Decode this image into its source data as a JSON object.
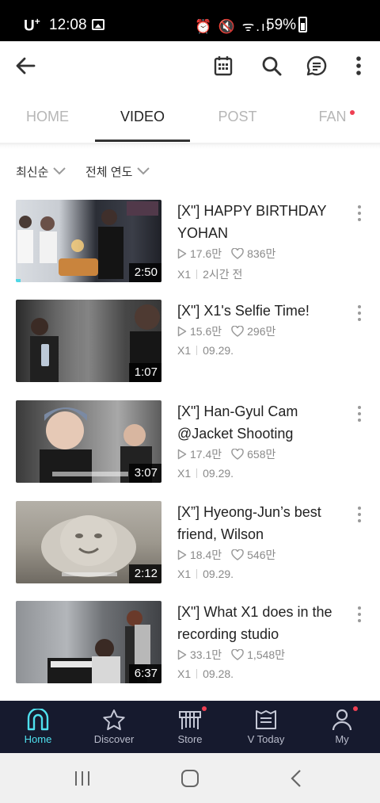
{
  "status_bar": {
    "carrier": "U",
    "carrier_sup": "+",
    "time": "12:08",
    "icons_text": "⏰ 🔇 ᯤ.ıl",
    "battery_percent": "59%"
  },
  "toolbar": {
    "back_icon": "back-arrow-icon",
    "calendar_icon": "calendar-icon",
    "search_icon": "search-icon",
    "chat_icon": "chat-icon",
    "more_icon": "more-vertical-icon"
  },
  "tabs": [
    {
      "label": "HOME",
      "active": false
    },
    {
      "label": "VIDEO",
      "active": true
    },
    {
      "label": "POST",
      "active": false
    },
    {
      "label": "FAN",
      "active": false,
      "has_notification": true
    }
  ],
  "filters": {
    "sort_label": "최신순",
    "year_label": "전체 연도"
  },
  "videos": [
    {
      "title": "[X\"] HAPPY BIRTHDAY YOHAN",
      "duration": "2:50",
      "views": "17.6만",
      "likes": "836만",
      "channel": "X1",
      "date": "2시간 전",
      "watched_fraction": 0.03
    },
    {
      "title": "[X\"] X1's Selfie Time!",
      "duration": "1:07",
      "views": "15.6만",
      "likes": "296만",
      "channel": "X1",
      "date": "09.29."
    },
    {
      "title": "[X\"] Han-Gyul Cam @Jacket Shooting",
      "duration": "3:07",
      "views": "17.4만",
      "likes": "658만",
      "channel": "X1",
      "date": "09.29."
    },
    {
      "title": "[X”] Hyeong-Jun’s best friend, Wilson",
      "duration": "2:12",
      "views": "18.4만",
      "likes": "546만",
      "channel": "X1",
      "date": "09.29."
    },
    {
      "title": "[X\"] What X1 does in the recording studio",
      "duration": "6:37",
      "views": "33.1만",
      "likes": "1,548만",
      "channel": "X1",
      "date": "09.28."
    }
  ],
  "bottom_nav": [
    {
      "label": "Home",
      "icon": "home-icon",
      "active": true
    },
    {
      "label": "Discover",
      "icon": "star-icon",
      "active": false
    },
    {
      "label": "Store",
      "icon": "store-icon",
      "active": false,
      "has_notification": true
    },
    {
      "label": "V Today",
      "icon": "v-today-icon",
      "active": false
    },
    {
      "label": "My",
      "icon": "person-icon",
      "active": false,
      "has_notification": true
    }
  ],
  "colors": {
    "accent": "#4fe0ee",
    "notification": "#ef3f52",
    "nav_background": "#161a2e"
  }
}
